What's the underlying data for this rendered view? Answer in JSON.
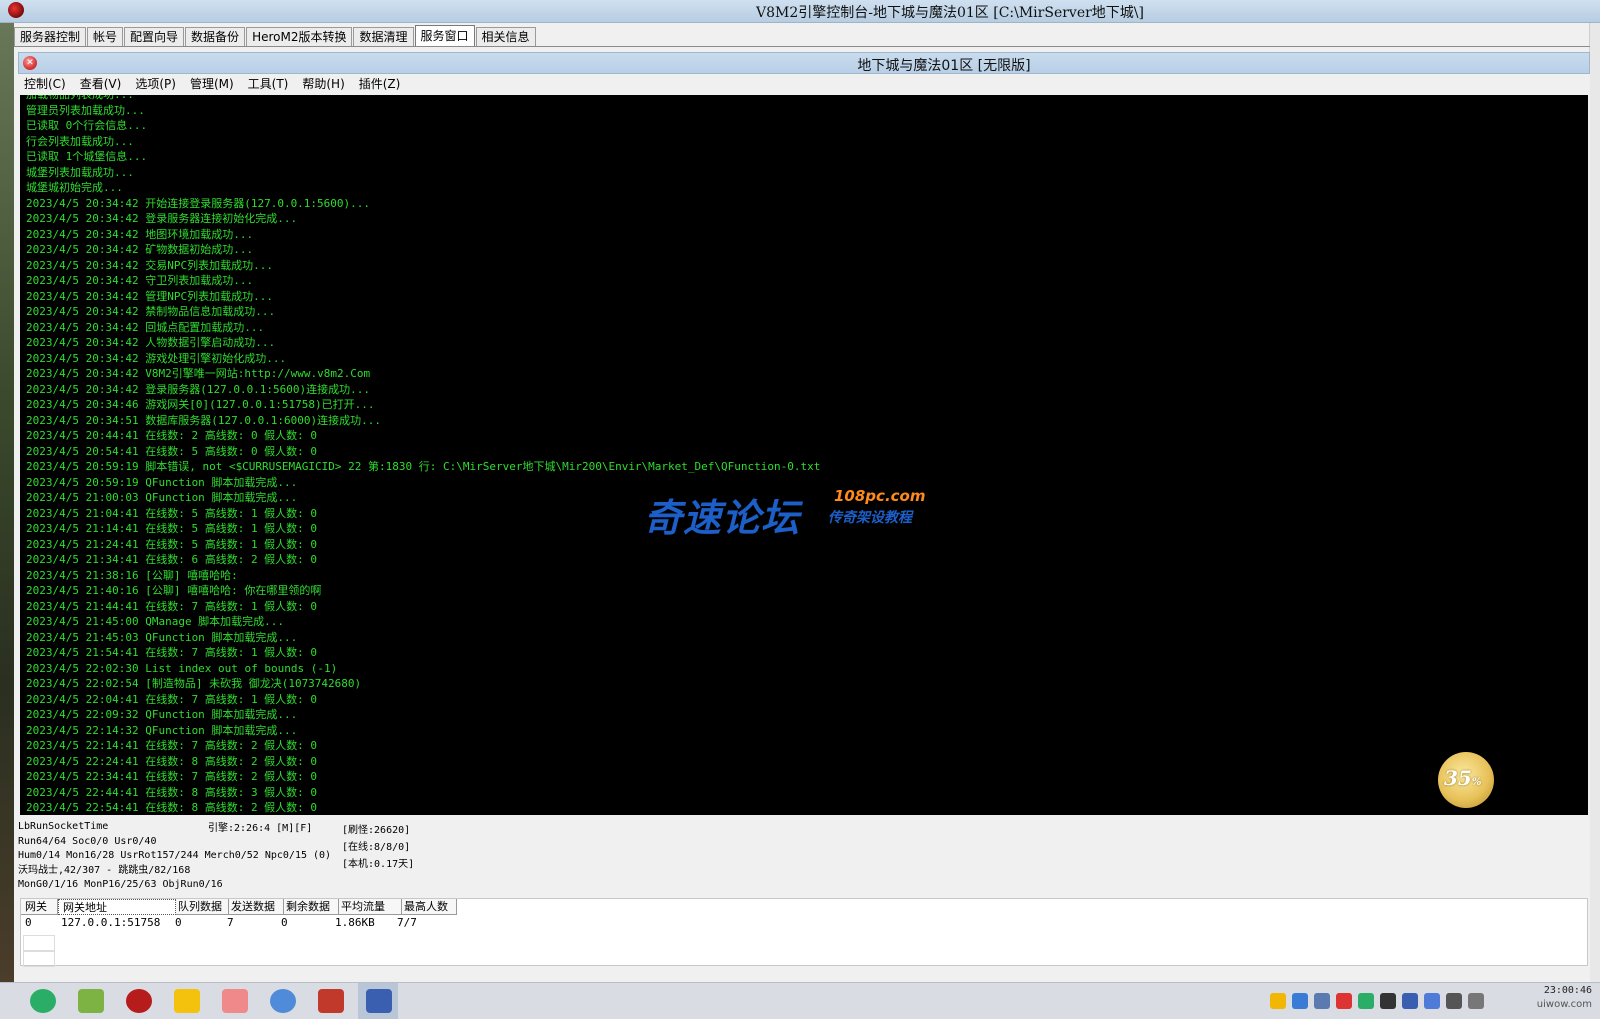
{
  "window": {
    "title": "V8M2引擎控制台-地下城与魔法01区 [C:\\MirServer地下城\\]"
  },
  "tabs": [
    {
      "label": "服务器控制"
    },
    {
      "label": "帐号"
    },
    {
      "label": "配置向导"
    },
    {
      "label": "数据备份"
    },
    {
      "label": "HeroM2版本转换"
    },
    {
      "label": "数据清理"
    },
    {
      "label": "服务窗口",
      "active": true
    },
    {
      "label": "相关信息"
    }
  ],
  "inner": {
    "title": "地下城与魔法01区 [无限版]",
    "menu": [
      "控制(C)",
      "查看(V)",
      "选项(P)",
      "管理(M)",
      "工具(T)",
      "帮助(H)",
      "插件(Z)"
    ]
  },
  "console_lines": [
    "加载物品列表成功...",
    "管理员列表加载成功...",
    "已读取 0个行会信息...",
    "行会列表加载成功...",
    "已读取 1个城堡信息...",
    "城堡列表加载成功...",
    "城堡城初始完成...",
    "2023/4/5 20:34:42 开始连接登录服务器(127.0.0.1:5600)...",
    "2023/4/5 20:34:42 登录服务器连接初始化完成...",
    "2023/4/5 20:34:42 地图环境加载成功...",
    "2023/4/5 20:34:42 矿物数据初始成功...",
    "2023/4/5 20:34:42 交易NPC列表加载成功...",
    "2023/4/5 20:34:42 守卫列表加载成功...",
    "2023/4/5 20:34:42 管理NPC列表加载成功...",
    "2023/4/5 20:34:42 禁制物品信息加载成功...",
    "2023/4/5 20:34:42 回城点配置加载成功...",
    "2023/4/5 20:34:42 人物数据引擎启动成功...",
    "2023/4/5 20:34:42 游戏处理引擎初始化成功...",
    "2023/4/5 20:34:42 V8M2引擎唯一网站:http://www.v8m2.Com",
    "2023/4/5 20:34:42 登录服务器(127.0.0.1:5600)连接成功...",
    "2023/4/5 20:34:46 游戏网关[0](127.0.0.1:51758)已打开...",
    "2023/4/5 20:34:51 数据库服务器(127.0.0.1:6000)连接成功...",
    "2023/4/5 20:44:41 在线数: 2 高线数: 0 假人数: 0",
    "2023/4/5 20:54:41 在线数: 5 高线数: 0 假人数: 0",
    "2023/4/5 20:59:19 脚本错误, not <$CURRUSEMAGICID> 22 第:1830 行: C:\\MirServer地下城\\Mir200\\Envir\\Market_Def\\QFunction-0.txt",
    "2023/4/5 20:59:19 QFunction 脚本加载完成...",
    "2023/4/5 21:00:03 QFunction 脚本加载完成...",
    "2023/4/5 21:04:41 在线数: 5 高线数: 1 假人数: 0",
    "2023/4/5 21:14:41 在线数: 5 高线数: 1 假人数: 0",
    "2023/4/5 21:24:41 在线数: 5 高线数: 1 假人数: 0",
    "2023/4/5 21:34:41 在线数: 6 高线数: 2 假人数: 0",
    "2023/4/5 21:38:16 [公聊] 嘻嘻哈哈:",
    "2023/4/5 21:40:16 [公聊] 嘻嘻哈哈: 你在哪里领的啊",
    "2023/4/5 21:44:41 在线数: 7 高线数: 1 假人数: 0",
    "2023/4/5 21:45:00 QManage 脚本加载完成...",
    "2023/4/5 21:45:03 QFunction 脚本加载完成...",
    "2023/4/5 21:54:41 在线数: 7 高线数: 1 假人数: 0",
    "2023/4/5 22:02:30 List index out of bounds (-1)",
    "2023/4/5 22:02:54 [制造物品] 未砍我 御龙决(1073742680)",
    "2023/4/5 22:04:41 在线数: 7 高线数: 1 假人数: 0",
    "2023/4/5 22:09:32 QFunction 脚本加载完成...",
    "2023/4/5 22:14:32 QFunction 脚本加载完成...",
    "2023/4/5 22:14:41 在线数: 7 高线数: 2 假人数: 0",
    "2023/4/5 22:24:41 在线数: 8 高线数: 2 假人数: 0",
    "2023/4/5 22:34:41 在线数: 7 高线数: 2 假人数: 0",
    "2023/4/5 22:44:41 在线数: 8 高线数: 3 假人数: 0",
    "2023/4/5 22:54:41 在线数: 8 高线数: 2 假人数: 0"
  ],
  "watermark": {
    "main": "奇速论坛",
    "domain": "108pc.com",
    "sub": "传奇架设教程"
  },
  "status": {
    "left": [
      "LbRunSocketTime",
      "Run64/64 Soc0/0 Usr0/40",
      "Hum0/14 Mon16/28 UsrRot157/244 Merch0/52 Npc0/15 (0)",
      "沃玛战士,42/307 - 跳跳虫/82/168",
      "MonG0/1/16 MonP16/25/63 ObjRun0/16"
    ],
    "mid": "引擎:2:26:4 [M][F]",
    "right": [
      "[刷怪:26620]",
      "[在线:8/8/0]",
      "[本机:0.17天]"
    ]
  },
  "progress": {
    "value": 35,
    "text": "35",
    "unit": "%"
  },
  "gateway_table": {
    "headers": [
      "网关",
      "网关地址",
      "队列数据",
      "发送数据",
      "剩余数据",
      "平均流量",
      "最高人数"
    ],
    "rows": [
      [
        "0",
        "127.0.0.1:51758",
        "0",
        "7",
        "0",
        "1.86KB",
        "7/7"
      ]
    ]
  },
  "taskbar": {
    "time": "23:00:46",
    "site": "uiwow.com",
    "apps": [
      "wechat-icon",
      "notepad-icon",
      "game-icon",
      "help-icon",
      "folder-icon",
      "network-icon",
      "legend-icon",
      "m2-server-icon"
    ],
    "colors": {
      "wechat": "#2aae67",
      "notepad": "#7cb342",
      "game": "#b71c1c",
      "help": "#f4c20d",
      "folder": "#f08a8a",
      "network": "#4f8bd8",
      "legend": "#c0392b",
      "m2": "#3a5fb0"
    }
  },
  "colors": {
    "console_bg": "#000000",
    "console_text": "#2fdc2f",
    "watermark_blue": "#1c5fc8",
    "watermark_orange": "#ff8a1c"
  }
}
